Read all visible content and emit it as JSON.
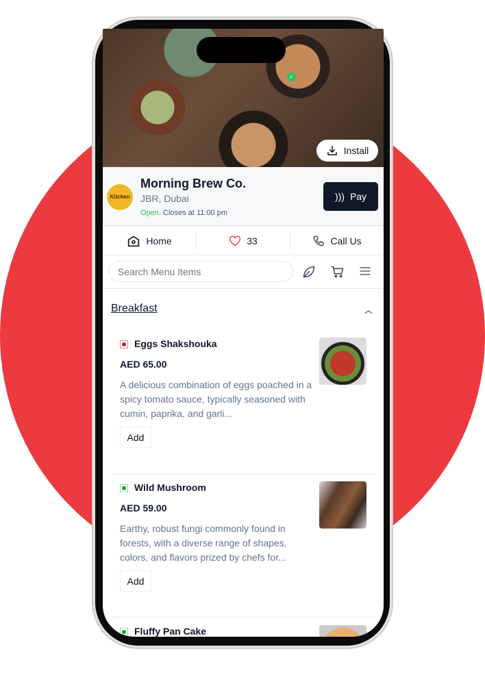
{
  "restaurant": {
    "name": "Morning Brew Co.",
    "location": "JBR, Dubai",
    "open_label": "Open.",
    "closes": "Closes at 11:00 pm",
    "logo_text": "Kitchen"
  },
  "hero": {
    "install_label": "Install"
  },
  "pay_label": "Pay",
  "nav": {
    "home": "Home",
    "likes": "33",
    "call": "Call Us"
  },
  "search": {
    "placeholder": "Search Menu Items"
  },
  "category": "Breakfast",
  "colors": {
    "accent": "#ec3a3f",
    "nonveg": "#c81e3a",
    "veg": "#16a34a",
    "dark": "#111827"
  },
  "items": [
    {
      "name": "Eggs Shakshouka",
      "price": "AED 65.00",
      "desc": "A delicious combination of eggs poached in a spicy tomato sauce, typically seasoned with cumin, paprika, and garli...",
      "add": "Add",
      "type": "non-veg"
    },
    {
      "name": "Wild Mushroom",
      "price": "AED 59.00",
      "desc": "Earthy, robust fungi commonly found in forests, with a diverse range of shapes, colors, and flavors prized by chefs for...",
      "add": "Add",
      "type": "veg"
    },
    {
      "name": "Fluffy Pan Cake",
      "type": "veg"
    }
  ]
}
